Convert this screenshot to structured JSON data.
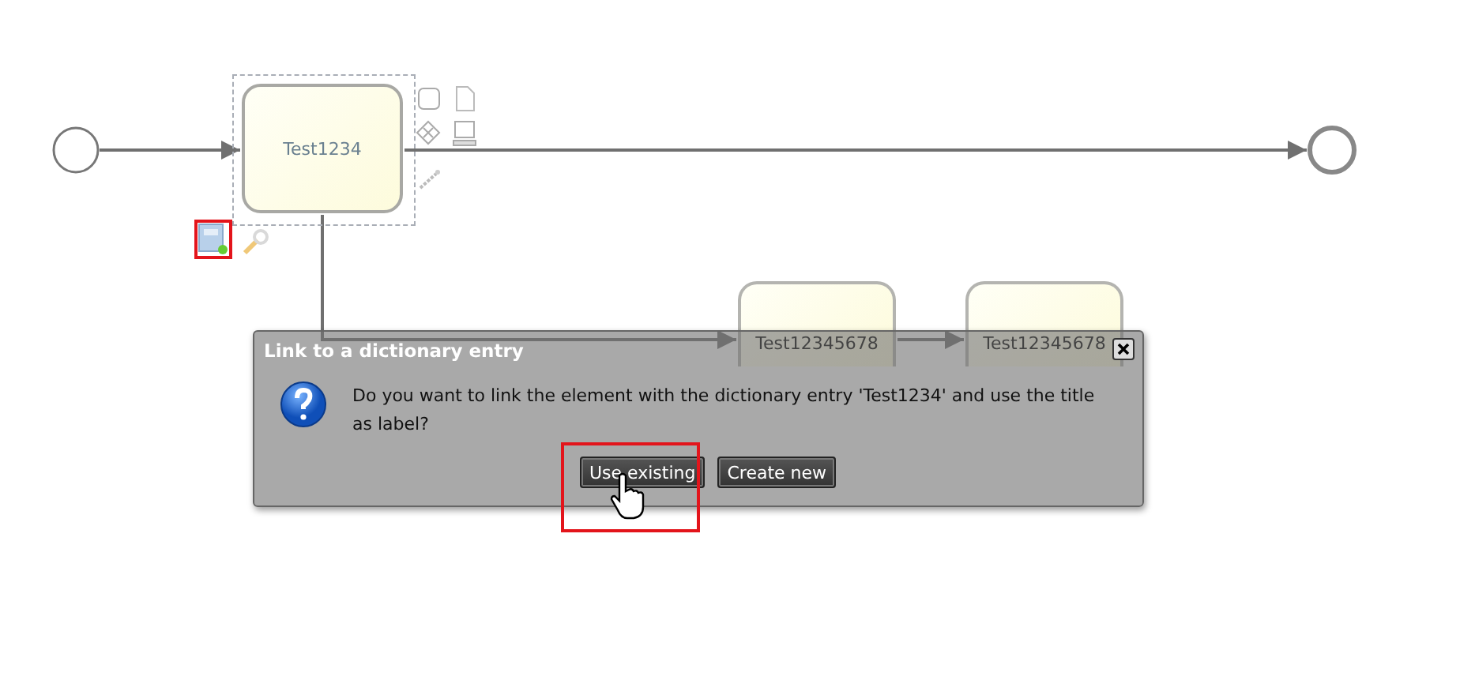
{
  "diagram": {
    "tasks": [
      {
        "label": "Test1234",
        "selected": true
      },
      {
        "label": "Test12345678",
        "selected": false
      },
      {
        "label": "Test12345678",
        "selected": false
      }
    ]
  },
  "dialog": {
    "title": "Link to a dictionary entry",
    "message": "Do you want to link the element with the dictionary entry 'Test1234' and use the title as label?",
    "buttons": [
      {
        "label": "Use existing"
      },
      {
        "label": "Create new"
      }
    ]
  }
}
